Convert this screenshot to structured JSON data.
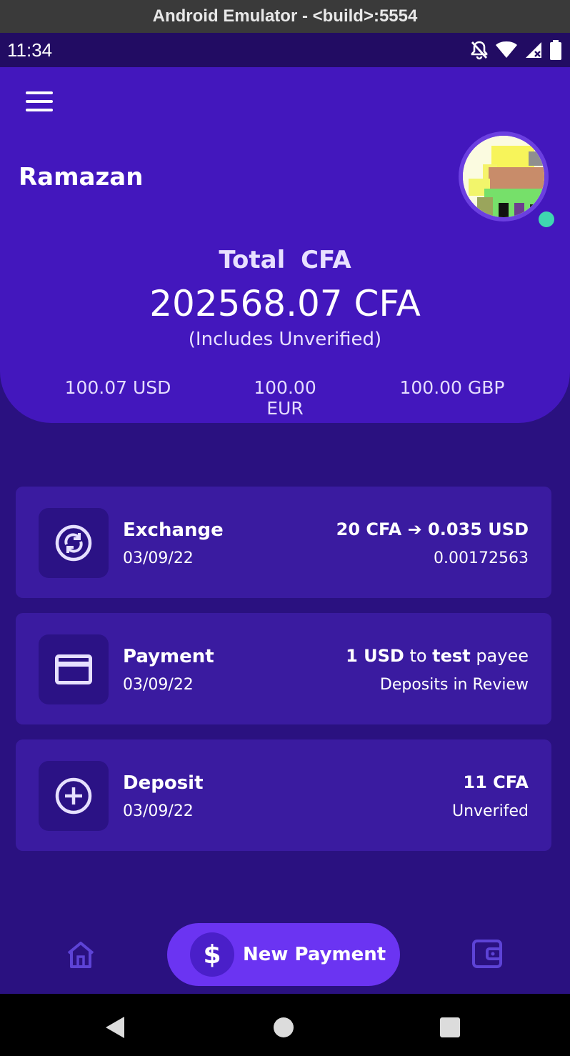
{
  "emulator": {
    "title": "Android Emulator - <build>:5554"
  },
  "status_bar": {
    "time": "11:34"
  },
  "header": {
    "user_name": "Ramazan",
    "total_label": "Total  CFA",
    "total_amount": "202568.07 CFA",
    "total_note": "(Includes Unverified)",
    "balances": [
      "100.07 USD",
      "100.00 EUR",
      "100.00 GBP"
    ]
  },
  "transactions": [
    {
      "title": "Exchange",
      "date": "03/09/22",
      "amount": "20 CFA ➔ 0.035 USD",
      "sub": "0.00172563",
      "icon": "exchange-icon"
    },
    {
      "title": "Payment",
      "date": "03/09/22",
      "amount_parts": [
        "1 USD",
        " to ",
        "test",
        " payee"
      ],
      "sub": "Deposits in Review",
      "icon": "card-icon"
    },
    {
      "title": "Deposit",
      "date": "03/09/22",
      "amount": "11 CFA",
      "sub": "Unverifed",
      "icon": "plus-circle-icon"
    }
  ],
  "bottom_nav": {
    "new_payment_label": "New Payment",
    "new_payment_symbol": "$",
    "items": [
      "home-icon",
      "wallet-icon"
    ]
  },
  "colors": {
    "background": "#2a1180",
    "header": "#4317bd",
    "card": "#3a1ba0",
    "accent": "#6b34f2",
    "online": "#3fd6b0"
  }
}
